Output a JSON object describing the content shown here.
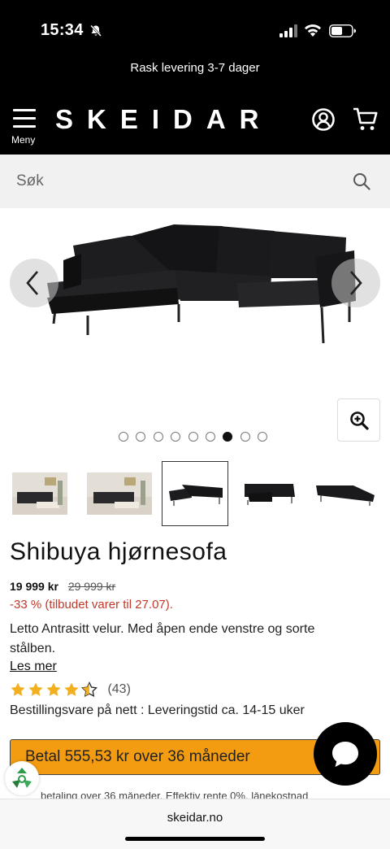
{
  "status_bar": {
    "time": "15:34",
    "icons": [
      "bell-slash-icon",
      "signal-icon",
      "wifi-icon",
      "battery-icon"
    ]
  },
  "promo": {
    "text": "Rask levering 3-7 dager"
  },
  "header": {
    "menu_label": "Meny",
    "logo": "SKEIDAR",
    "icons": [
      "user-icon",
      "cart-icon"
    ]
  },
  "search": {
    "placeholder": "Søk"
  },
  "gallery": {
    "total_images": 9,
    "active_index": 7,
    "thumbnail_count": 6
  },
  "product": {
    "title": "Shibuya hjørnesofa",
    "price": "19 999 kr",
    "old_price": "29 999 kr",
    "discount": "-33 % (tilbudet varer til 27.07).",
    "description": "Letto Antrasitt velur. Med åpen ende venstre og sorte stålben.",
    "read_more": "Les mer",
    "rating_stars": 4.5,
    "rating_count": "(43)",
    "availability": "Bestillingsvare på nett : Leveringstid ca. 14-15 uker"
  },
  "financing": {
    "button_label": "Betal 555,53 kr over 36 måneder",
    "note": "betaling over 36 måneder. Effektiv rente 0%, lånekostnad"
  },
  "browser": {
    "url": "skeidar.no"
  },
  "colors": {
    "accent": "#f39c12",
    "discount": "#c0392b",
    "header_bg": "#000000"
  }
}
